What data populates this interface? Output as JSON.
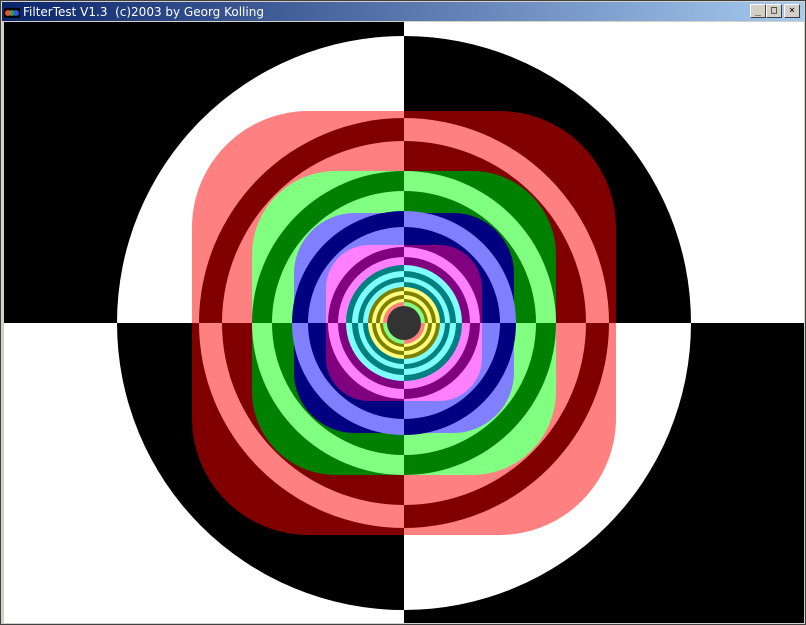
{
  "window": {
    "title": "FilterTest V1.3  (c)2003 by Georg Kolling",
    "controls": {
      "minimize": "_",
      "maximize": "□",
      "close": "×"
    }
  },
  "test_pattern": {
    "colors": {
      "black": "#000000",
      "white": "#ffffff",
      "light_red": "#ff8080",
      "dark_red": "#800000",
      "light_green": "#80ff80",
      "dark_green": "#008000",
      "light_blue": "#8080ff",
      "dark_blue": "#000080",
      "light_magenta": "#ff80ff",
      "dark_magenta": "#800080",
      "cyan": "#80ffff",
      "teal": "#008080",
      "yellow": "#ffff80",
      "olive": "#808000",
      "center": "#333333"
    }
  }
}
